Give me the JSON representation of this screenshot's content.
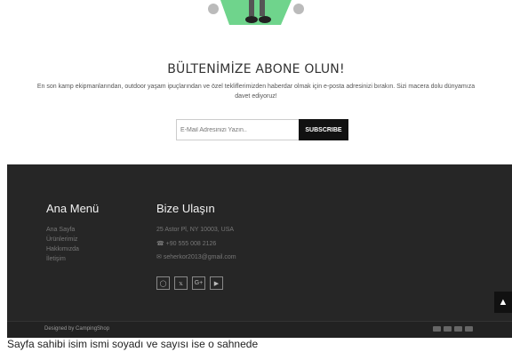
{
  "newsletter": {
    "title": "BÜLTENİMİZE ABONE OLUN!",
    "description": "En son kamp ekipmanlarından, outdoor yaşam ipuçlarından ve özel tekliflerimizden haberdar olmak için e-posta adresinizi bırakın. Sizi macera dolu dünyamıza davet ediyoruz!",
    "input_placeholder": "E-Mail Adresinizi Yazın..",
    "button_label": "SUBSCRIBE"
  },
  "footer": {
    "menu_title": "Ana Menü",
    "menu_items": [
      "Ana Sayfa",
      "Ürünlerimiz",
      "Hakkımızda",
      "İletişim"
    ],
    "contact_title": "Bize Ulaşın",
    "address": "25 Astor Pl, NY 10003, USA",
    "phone": "+90 555 008 2126",
    "email": "seherkor2013@gmail.com",
    "social_icons": [
      "instagram-icon",
      "twitter-icon",
      "google-plus-icon",
      "youtube-icon"
    ],
    "designed_by": "Designed by CampingShop",
    "payment_icons": [
      "card-icon",
      "card-icon",
      "card-icon",
      "card-icon"
    ]
  },
  "bottom_text": "Sayfa sahibi isim ismi soyadı ve sayısı ise o sahnede"
}
